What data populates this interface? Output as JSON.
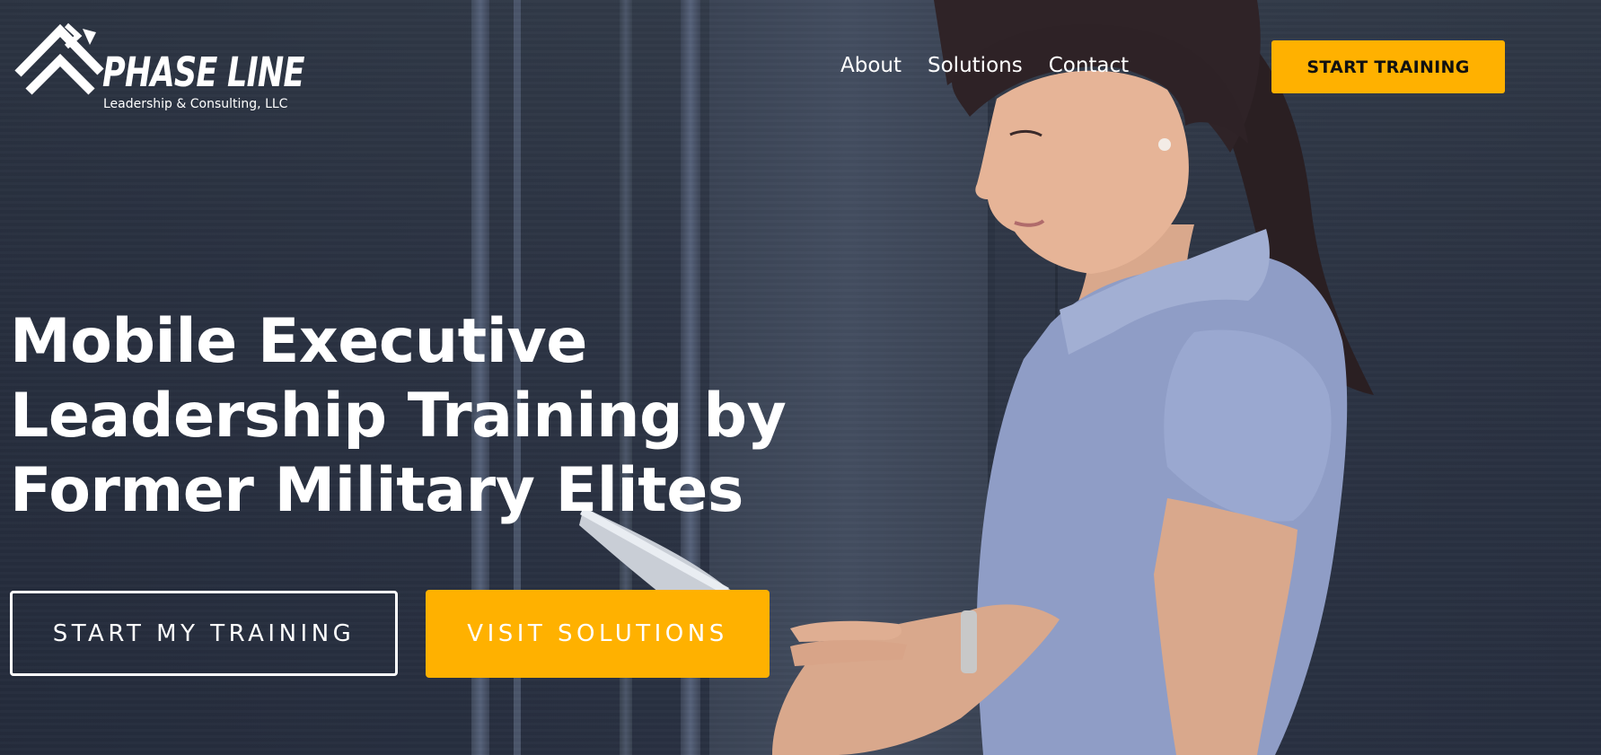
{
  "brand": {
    "name": "PHASE LINE",
    "tagline": "Leadership & Consulting, LLC"
  },
  "nav": {
    "items": [
      {
        "label": "About"
      },
      {
        "label": "Solutions"
      },
      {
        "label": "Contact"
      }
    ],
    "cta_label": "START TRAINING"
  },
  "hero": {
    "headline_lines": [
      "Mobile Executive",
      "Leadership Training by",
      "Former Military Elites"
    ],
    "primary_button": "START MY TRAINING",
    "secondary_button": "VISIT SOLUTIONS"
  },
  "colors": {
    "accent": "#ffb100",
    "background": "#343c4c",
    "text": "#ffffff"
  },
  "icons": {
    "logo_mark": "chevron-stack-logo-icon"
  }
}
